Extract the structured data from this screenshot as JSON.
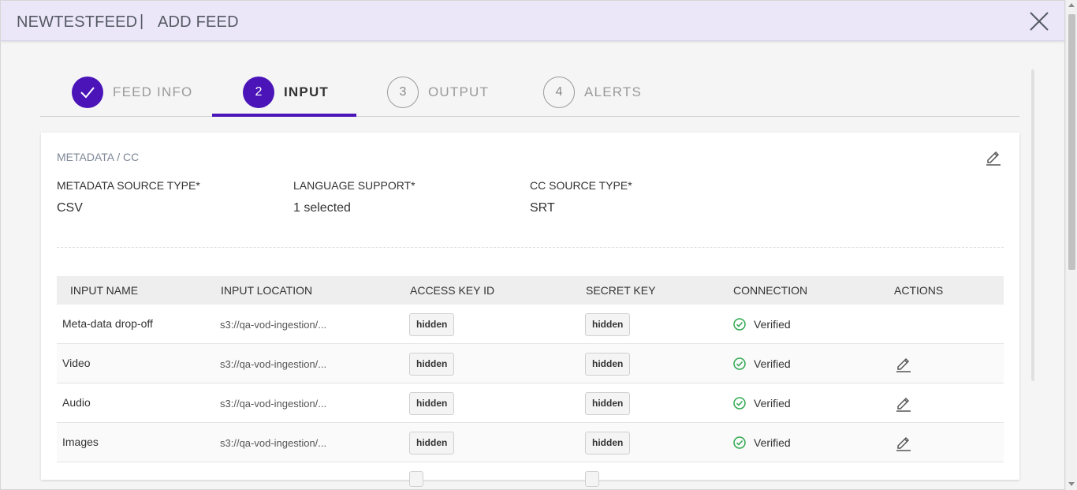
{
  "header": {
    "feed_name": "NEWTESTFEED",
    "separator": "|",
    "subtitle": "ADD FEED",
    "close_icon": "close-icon"
  },
  "tabs": [
    {
      "number": "1",
      "label": "FEED INFO",
      "state": "done"
    },
    {
      "number": "2",
      "label": "INPUT",
      "state": "active"
    },
    {
      "number": "3",
      "label": "OUTPUT",
      "state": "pending"
    },
    {
      "number": "4",
      "label": "ALERTS",
      "state": "pending"
    }
  ],
  "card": {
    "title": "METADATA / CC",
    "edit_icon": "pencil-icon",
    "fields": [
      {
        "label": "METADATA SOURCE TYPE*",
        "value": "CSV"
      },
      {
        "label": "LANGUAGE SUPPORT*",
        "value": "1 selected"
      },
      {
        "label": "CC SOURCE TYPE*",
        "value": "SRT"
      }
    ]
  },
  "table": {
    "columns": [
      "INPUT NAME",
      "INPUT LOCATION",
      "ACCESS KEY ID",
      "SECRET KEY",
      "CONNECTION",
      "ACTIONS"
    ],
    "rows": [
      {
        "name": "Meta-data drop-off",
        "location": "s3://qa-vod-ingestion/...",
        "access_key": "hidden",
        "secret_key": "hidden",
        "connection": "Verified",
        "editable": false
      },
      {
        "name": "Video",
        "location": "s3://qa-vod-ingestion/...",
        "access_key": "hidden",
        "secret_key": "hidden",
        "connection": "Verified",
        "editable": true
      },
      {
        "name": "Audio",
        "location": "s3://qa-vod-ingestion/...",
        "access_key": "hidden",
        "secret_key": "hidden",
        "connection": "Verified",
        "editable": true
      },
      {
        "name": "Images",
        "location": "s3://qa-vod-ingestion/...",
        "access_key": "hidden",
        "secret_key": "hidden",
        "connection": "Verified",
        "editable": true
      }
    ]
  },
  "colors": {
    "accent": "#4a14b8",
    "header_bg": "#ebe7f9",
    "verified": "#2fa84f"
  }
}
